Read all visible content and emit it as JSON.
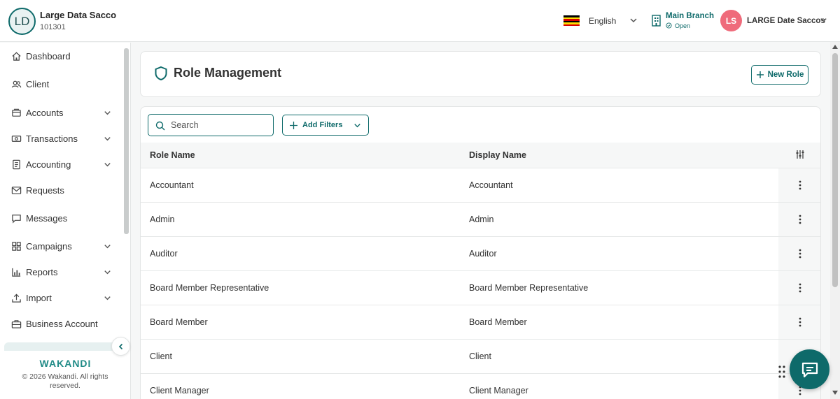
{
  "header": {
    "org_initials": "LD",
    "org_name": "Large Data Sacco",
    "org_code": "101301",
    "language": "English",
    "branch_name": "Main Branch",
    "branch_status": "Open",
    "user_initials": "LS",
    "user_name": "LARGE Date Saccos"
  },
  "sidebar": {
    "items": [
      {
        "label": "Dashboard",
        "icon": "home-icon",
        "expandable": false
      },
      {
        "label": "Client",
        "icon": "users-icon",
        "expandable": false
      },
      {
        "label": "Accounts",
        "icon": "wallet-icon",
        "expandable": true
      },
      {
        "label": "Transactions",
        "icon": "cash-icon",
        "expandable": true
      },
      {
        "label": "Accounting",
        "icon": "ledger-icon",
        "expandable": true
      },
      {
        "label": "Requests",
        "icon": "mail-icon",
        "expandable": false
      },
      {
        "label": "Messages",
        "icon": "chat-icon",
        "expandable": false
      },
      {
        "label": "Campaigns",
        "icon": "grid-icon",
        "expandable": true
      },
      {
        "label": "Reports",
        "icon": "bar-chart-icon",
        "expandable": true
      },
      {
        "label": "Import",
        "icon": "upload-icon",
        "expandable": true
      },
      {
        "label": "Business Account",
        "icon": "briefcase-icon",
        "expandable": false
      }
    ],
    "brand": "WAKANDI",
    "copyright": "© 2026 Wakandi. All rights reserved."
  },
  "page": {
    "title": "Role Management",
    "new_role_label": "New Role"
  },
  "toolbar": {
    "search_placeholder": "Search",
    "add_filters_label": "Add Filters"
  },
  "table": {
    "columns": [
      "Role Name",
      "Display Name"
    ],
    "rows": [
      {
        "role_name": "Accountant",
        "display_name": "Accountant"
      },
      {
        "role_name": "Admin",
        "display_name": "Admin"
      },
      {
        "role_name": "Auditor",
        "display_name": "Auditor"
      },
      {
        "role_name": "Board Member Representative",
        "display_name": "Board Member Representative"
      },
      {
        "role_name": "Board Member",
        "display_name": "Board Member"
      },
      {
        "role_name": "Client",
        "display_name": "Client"
      },
      {
        "role_name": "Client Manager",
        "display_name": "Client Manager"
      }
    ]
  },
  "colors": {
    "accent": "#0e6a6a",
    "avatar": "#ef6b7b"
  }
}
